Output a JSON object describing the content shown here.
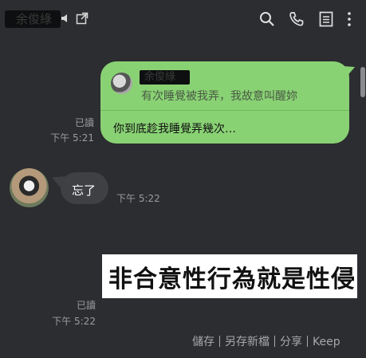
{
  "header": {
    "contact_name": "余俊綠",
    "icons": [
      "speaker-icon",
      "external-link-icon",
      "search-icon",
      "phone-icon",
      "notes-icon",
      "more-icon"
    ]
  },
  "messages": {
    "reply": {
      "quote_name": "余俊綠",
      "quote_text": "有次睡覺被我弄，我故意叫醒妳",
      "text": "你到底趁我睡覺弄幾次…",
      "read": "已讀",
      "time": "下午 5:21"
    },
    "incoming": {
      "text": "忘了",
      "time": "下午 5:22"
    },
    "image": {
      "text": "非合意性行為就是性侵",
      "read": "已讀",
      "time": "下午 5:22"
    }
  },
  "actions": {
    "save": "儲存",
    "save_new_album": "另存新檔",
    "share": "分享",
    "keep": "Keep"
  },
  "colors": {
    "background": "#2b2d30",
    "bubble_green": "#89d274",
    "bubble_grey": "#3e4044"
  }
}
